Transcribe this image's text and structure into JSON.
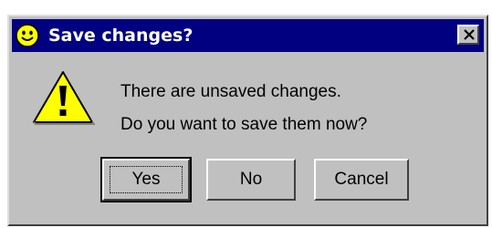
{
  "window": {
    "title": "Save changes?",
    "title_icon": "smiley-icon",
    "close_icon": "close-icon"
  },
  "message": {
    "icon": "warning-icon",
    "line1": "There are unsaved changes.",
    "line2": "Do you want to save them now?"
  },
  "buttons": {
    "yes": "Yes",
    "no": "No",
    "cancel": "Cancel",
    "default": "yes"
  },
  "colors": {
    "titlebar": "#000080",
    "face": "#c0c0c0",
    "warning": "#ffff00"
  }
}
